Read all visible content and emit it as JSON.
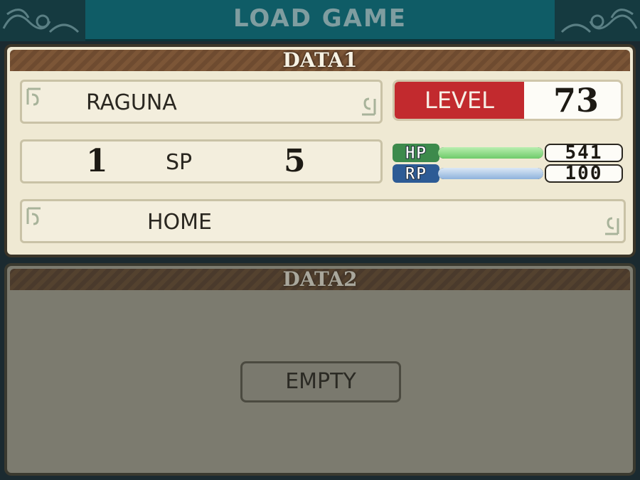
{
  "header": {
    "title": "LOAD GAME"
  },
  "slots": [
    {
      "title": "DATA1",
      "name": "RAGUNA",
      "level_label": "LEVEL",
      "level": "73",
      "sp_label": "SP",
      "sp_left": "1",
      "sp_right": "5",
      "hp_label": "HP",
      "hp": "541",
      "hp_fill": 1.0,
      "rp_label": "RP",
      "rp": "100",
      "rp_fill": 1.0,
      "location": "HOME"
    },
    {
      "title": "DATA2",
      "empty_label": "EMPTY"
    }
  ],
  "colors": {
    "header": "#0f5c66",
    "level_red": "#c22a2e",
    "hp_green": "#6fcb6a",
    "rp_blue": "#8fb2dc"
  }
}
